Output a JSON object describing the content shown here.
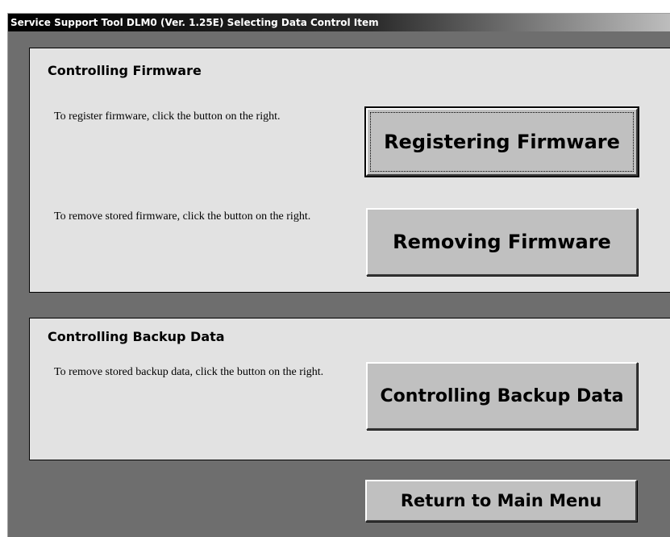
{
  "window": {
    "title": "Service Support Tool DLM0 (Ver. 1.25E)  Selecting Data Control Item"
  },
  "firmware_panel": {
    "title": "Controlling Firmware",
    "register_desc": "To register firmware, click the button on the right.",
    "register_button": "Registering Firmware",
    "remove_desc": "To remove stored firmware, click the button on the right.",
    "remove_button": "Removing Firmware"
  },
  "backup_panel": {
    "title": "Controlling Backup Data",
    "remove_desc": "To remove stored backup data, click the button on the right.",
    "button": "Controlling Backup Data"
  },
  "footer": {
    "return_button": "Return to Main Menu"
  },
  "colors": {
    "window_bg": "#6e6e6e",
    "panel_bg": "#e2e2e2",
    "button_face": "#c0c0c0"
  }
}
